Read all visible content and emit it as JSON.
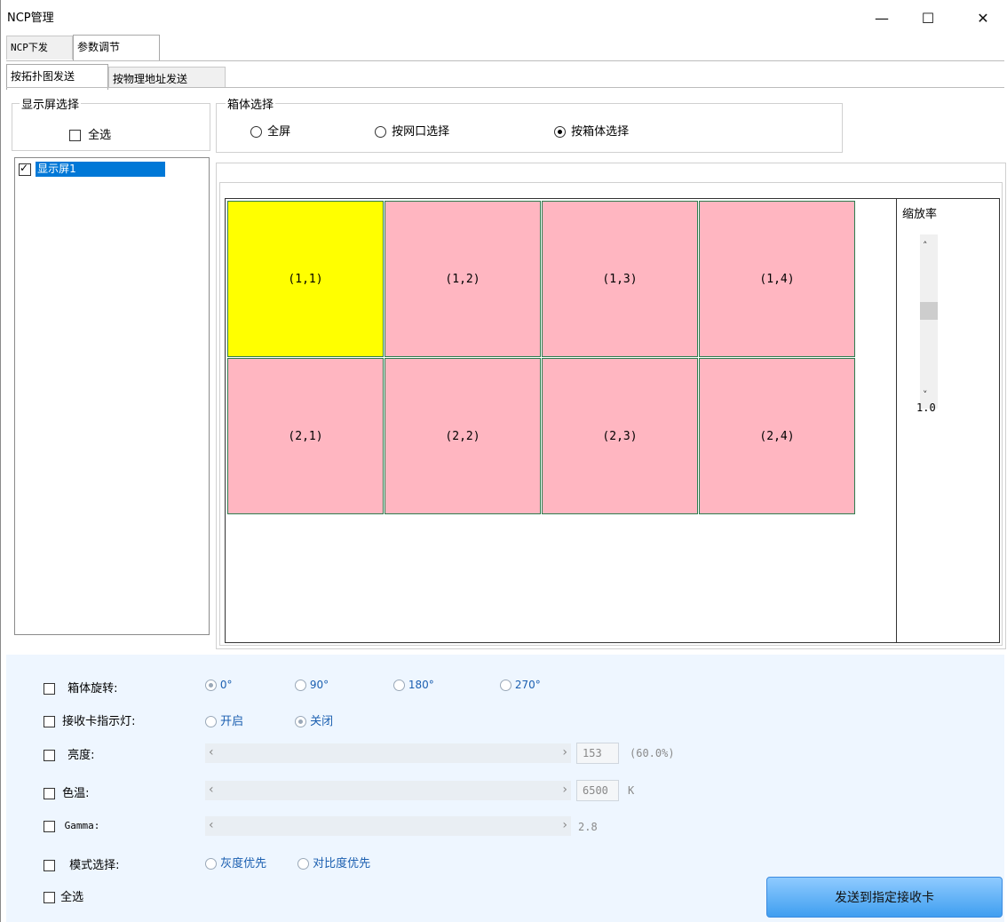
{
  "window": {
    "title": "NCP管理",
    "min": "—",
    "max": "☐",
    "close": "✕"
  },
  "tabs": [
    "NCP下发",
    "参数调节"
  ],
  "subtabs": [
    "按拓扑图发送",
    "按物理地址发送"
  ],
  "screen_select": {
    "group_label": "显示屏选择",
    "select_all": "全选",
    "screens": [
      {
        "label": "显示屏1",
        "checked": true
      }
    ]
  },
  "cabinet_select": {
    "group_label": "箱体选择",
    "options": [
      "全屏",
      "按网口选择",
      "按箱体选择"
    ],
    "selected": "按箱体选择"
  },
  "grid": {
    "cells": [
      {
        "label": "(1,1)",
        "color": "#ffff00"
      },
      {
        "label": "(1,2)",
        "color": "#ffb6c1"
      },
      {
        "label": "(1,3)",
        "color": "#ffb6c1"
      },
      {
        "label": "(1,4)",
        "color": "#ffb6c1"
      },
      {
        "label": "(2,1)",
        "color": "#ffb6c1"
      },
      {
        "label": "(2,2)",
        "color": "#ffb6c1"
      },
      {
        "label": "(2,3)",
        "color": "#ffb6c1"
      },
      {
        "label": "(2,4)",
        "color": "#ffb6c1"
      }
    ]
  },
  "zoom": {
    "label": "缩放率",
    "value": "1.0"
  },
  "settings": {
    "rotation": {
      "label": "箱体旋转:",
      "options": [
        "0°",
        "90°",
        "180°",
        "270°"
      ],
      "selected": "0°"
    },
    "indicator": {
      "label": "接收卡指示灯:",
      "options": [
        "开启",
        "关闭"
      ],
      "selected": "关闭"
    },
    "brightness": {
      "label": "亮度:",
      "value": "153",
      "percent": "(60.0%)"
    },
    "color_temp": {
      "label": "色温:",
      "value": "6500",
      "unit": "K"
    },
    "gamma": {
      "label": "Gamma:",
      "value": "2.8"
    },
    "mode": {
      "label": "模式选择:",
      "options": [
        "灰度优先",
        "对比度优先"
      ]
    },
    "select_all": "全选"
  },
  "send_button": "发送到指定接收卡",
  "colors": {
    "accent": "#0078d7",
    "cell_border": "#2e7d4f",
    "bottom_bg": "#eef6ff"
  }
}
